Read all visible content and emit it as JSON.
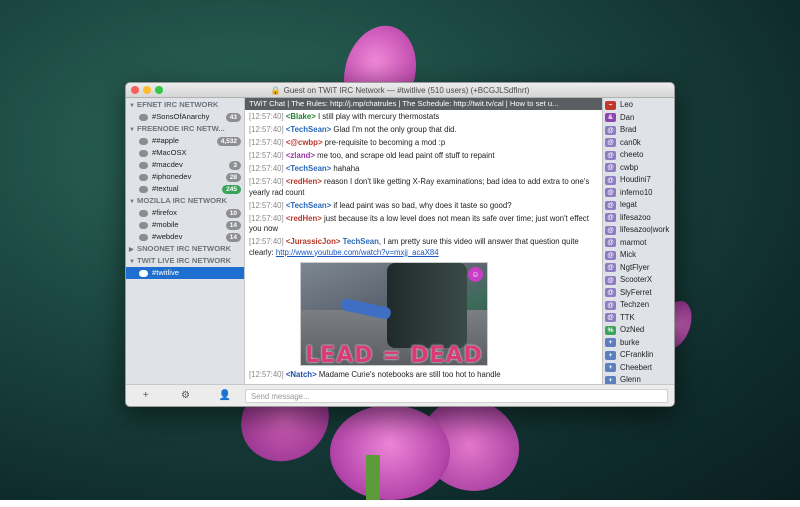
{
  "window": {
    "title": "Guest on TWiT IRC Network — #twitlive (510 users) (+BCGJLSdflnrt)"
  },
  "sidebar": {
    "networks": [
      {
        "name": "EFNET IRC NETWORK",
        "expanded": true,
        "channels": [
          {
            "name": "#SonsOfAnarchy",
            "badge": "43"
          }
        ]
      },
      {
        "name": "FREENODE IRC NETW...",
        "expanded": true,
        "channels": [
          {
            "name": "##apple",
            "badge": "4,532"
          },
          {
            "name": "#MacOSX",
            "badge": ""
          },
          {
            "name": "#macdev",
            "badge": "3"
          },
          {
            "name": "#iphonedev",
            "badge": "28"
          },
          {
            "name": "#textual",
            "badge": "245",
            "badge_color": "green"
          }
        ]
      },
      {
        "name": "MOZILLA IRC NETWORK",
        "expanded": true,
        "channels": [
          {
            "name": "#firefox",
            "badge": "10"
          },
          {
            "name": "#mobile",
            "badge": "14"
          },
          {
            "name": "#webdev",
            "badge": "14"
          }
        ]
      },
      {
        "name": "SNOONET IRC NETWORK",
        "expanded": false,
        "channels": []
      },
      {
        "name": "TWIT LIVE IRC NETWORK",
        "expanded": true,
        "channels": [
          {
            "name": "#twitlive",
            "badge": "",
            "selected": true
          }
        ]
      }
    ]
  },
  "chat": {
    "topic": "TWiT Chat | The Rules: http://j.mp/chatrules | The Schedule: http://twit.tv/cal | How to set u...",
    "messages": [
      {
        "time": "[12:57:40]",
        "nick": "<Blake>",
        "nick_class": "n-blake",
        "text": "I still play with mercury thermostats"
      },
      {
        "time": "[12:57:40]",
        "nick": "<TechSean>",
        "nick_class": "n-tech",
        "text": "Glad I'm not the only group that did."
      },
      {
        "time": "[12:57:40]",
        "nick": "<@cwbp>",
        "nick_class": "n-cwbp",
        "text": "pre-requisite to becoming a mod :p"
      },
      {
        "time": "[12:57:40]",
        "nick": "<zland>",
        "nick_class": "n-zland",
        "text": "me too, and scrape old lead paint off stuff to repaint"
      },
      {
        "time": "[12:57:40]",
        "nick": "<TechSean>",
        "nick_class": "n-tech",
        "text": "hahaha"
      },
      {
        "time": "[12:57:40]",
        "nick": "<redHen>",
        "nick_class": "n-red",
        "text": "reason I don't like getting X-Ray examinations; bad idea to add extra to one's yearly rad count"
      },
      {
        "time": "[12:57:40]",
        "nick": "<TechSean>",
        "nick_class": "n-tech",
        "text": "if lead paint was so bad, why does it taste so good?"
      },
      {
        "time": "[12:57:40]",
        "nick": "<redHen>",
        "nick_class": "n-red",
        "text": "just because its a low level does not mean its safe over time; just won't effect you now"
      },
      {
        "time": "[12:57:40]",
        "nick": "<JurassicJon>",
        "nick_class": "n-jur",
        "mention": "TechSean",
        "text": ", I am pretty sure this video will answer that question quite clearly: ",
        "link": "http://www.youtube.com/watch?v=mxjj_acaX84"
      }
    ],
    "embed_caption": "LEAD = DEAD",
    "last_message": {
      "time": "[12:57:40]",
      "nick": "<Natch>",
      "nick_class": "n-natch",
      "text": "Madame Curie's notebooks are still too hot to handle"
    },
    "input_placeholder": "Send message..."
  },
  "users": [
    {
      "name": "Leo",
      "mode": "~",
      "color": "#c0392b"
    },
    {
      "name": "Dan",
      "mode": "&",
      "color": "#8e44ad"
    },
    {
      "name": "Brad",
      "mode": "@",
      "color": "#8e7cc3"
    },
    {
      "name": "can0k",
      "mode": "@",
      "color": "#8e7cc3"
    },
    {
      "name": "cheeto",
      "mode": "@",
      "color": "#8e7cc3"
    },
    {
      "name": "cwbp",
      "mode": "@",
      "color": "#8e7cc3"
    },
    {
      "name": "Houdini7",
      "mode": "@",
      "color": "#8e7cc3"
    },
    {
      "name": "inferno10",
      "mode": "@",
      "color": "#8e7cc3"
    },
    {
      "name": "legat",
      "mode": "@",
      "color": "#8e7cc3"
    },
    {
      "name": "lifesazoo",
      "mode": "@",
      "color": "#8e7cc3"
    },
    {
      "name": "lifesazoo|work",
      "mode": "@",
      "color": "#8e7cc3"
    },
    {
      "name": "marmot",
      "mode": "@",
      "color": "#8e7cc3"
    },
    {
      "name": "Mick",
      "mode": "@",
      "color": "#8e7cc3"
    },
    {
      "name": "NgtFlyer",
      "mode": "@",
      "color": "#8e7cc3"
    },
    {
      "name": "ScooterX",
      "mode": "@",
      "color": "#8e7cc3"
    },
    {
      "name": "SlyFerret",
      "mode": "@",
      "color": "#8e7cc3"
    },
    {
      "name": "Techzen",
      "mode": "@",
      "color": "#8e7cc3"
    },
    {
      "name": "TTK",
      "mode": "@",
      "color": "#8e7cc3"
    },
    {
      "name": "OzNed",
      "mode": "%",
      "color": "#3aa55a"
    },
    {
      "name": "burke",
      "mode": "+",
      "color": "#5d7fbf"
    },
    {
      "name": "CFranklin",
      "mode": "+",
      "color": "#5d7fbf"
    },
    {
      "name": "Cheebert",
      "mode": "+",
      "color": "#5d7fbf"
    },
    {
      "name": "Glenn",
      "mode": "+",
      "color": "#5d7fbf"
    }
  ],
  "toolbar": {
    "add_icon": "plus-icon",
    "settings_icon": "gear-icon",
    "user_icon": "user-icon"
  }
}
